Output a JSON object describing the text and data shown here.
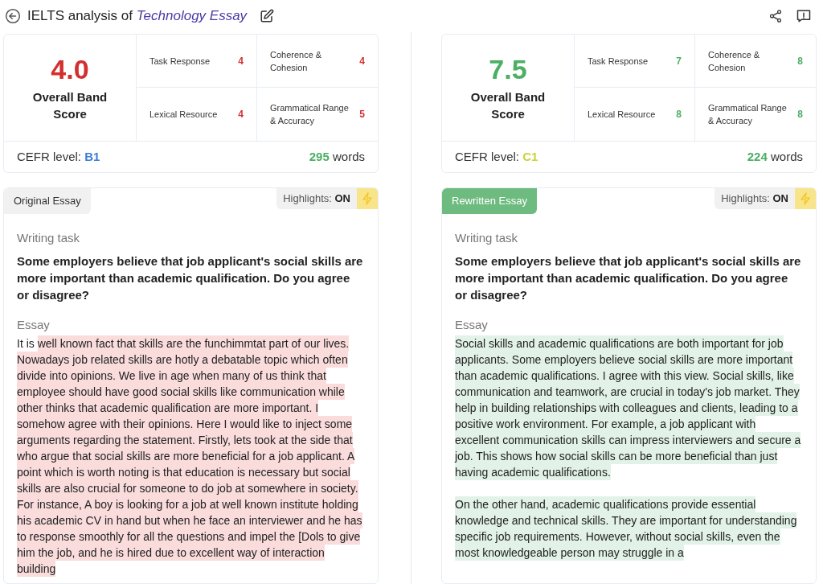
{
  "header": {
    "prefix": "IELTS analysis of",
    "essay_title": "Technology Essay"
  },
  "panels": [
    {
      "kind": "original",
      "overall": "4.0",
      "overall_label": "Overall Band Score",
      "criteria": [
        {
          "label": "Task Response",
          "score": "4"
        },
        {
          "label": "Coherence & Cohesion",
          "score": "4"
        },
        {
          "label": "Lexical Resource",
          "score": "4"
        },
        {
          "label": "Grammatical Range & Accuracy",
          "score": "5"
        }
      ],
      "cefr_label": "CEFR level:",
      "cefr_value": "B1",
      "word_count": "295",
      "word_unit": "words",
      "tab": {
        "label": "Original Essay",
        "selected": false
      },
      "highlights": {
        "label": "Highlights:",
        "value": "ON",
        "on": true
      },
      "task_heading": "Writing task",
      "task_text": "Some employers believe that job applicant's social skills are more important than academic qualification. Do you agree or disagree?",
      "essay_heading": "Essay",
      "paragraphs": [
        [
          {
            "text": "It is ",
            "highlighted": false
          },
          {
            "text": "well known fact that skills are the funchimmtat part of our lives. Nowadays job related skills are hotly a debatable topic which often divide into opinions. We live in age when many of us think that employee should have good social skills like communication while other thinks that academic qualification are more important. I somehow agree with their opinions. Here I would like to inject some arguments regarding the statement. Firstly, lets took at the side that who argue that social skills are more beneficial for a job applicant. A point which is worth noting is that education is necessary but social skills are also crucial for someone to do job at somewhere in society. For instance, A boy is looking for a job at well known institute holding his academic CV in hand but when he face an interviewer and he has to response smoothly for all the questions and impel the [Dols to give him the job, and he is hired due to excellent way of interaction building",
            "highlighted": true
          }
        ]
      ]
    },
    {
      "kind": "rewritten",
      "overall": "7.5",
      "overall_label": "Overall Band Score",
      "criteria": [
        {
          "label": "Task Response",
          "score": "7"
        },
        {
          "label": "Coherence & Cohesion",
          "score": "8"
        },
        {
          "label": "Lexical Resource",
          "score": "8"
        },
        {
          "label": "Grammatical Range & Accuracy",
          "score": "8"
        }
      ],
      "cefr_label": "CEFR level:",
      "cefr_value": "C1",
      "word_count": "224",
      "word_unit": "words",
      "tab": {
        "label": "Rewritten Essay",
        "selected": true
      },
      "highlights": {
        "label": "Highlights:",
        "value": "ON",
        "on": true
      },
      "task_heading": "Writing task",
      "task_text": "Some employers believe that job applicant's social skills are more important than academic qualification. Do you agree or disagree?",
      "essay_heading": "Essay",
      "paragraphs": [
        [
          {
            "text": "Social skills and academic qualifications are both important for job applicants. Some employers believe social skills are more important than academic qualifications. I agree with this view. Social skills, like communication and teamwork, are crucial in today's job market. They help in building relationships with colleagues and clients, leading to a positive work environment. For example, a job applicant with excellent communication skills can impress interviewers and secure a job. This shows how social skills can be more beneficial than just having academic qualifications.",
            "highlighted": true
          }
        ],
        [
          {
            "text": "On the other hand, academic qualifications provide essential knowledge and technical skills. They are important for understanding specific job requirements. However, without social skills, even the most knowledgeable person may struggle in a",
            "highlighted": true
          }
        ]
      ]
    }
  ]
}
